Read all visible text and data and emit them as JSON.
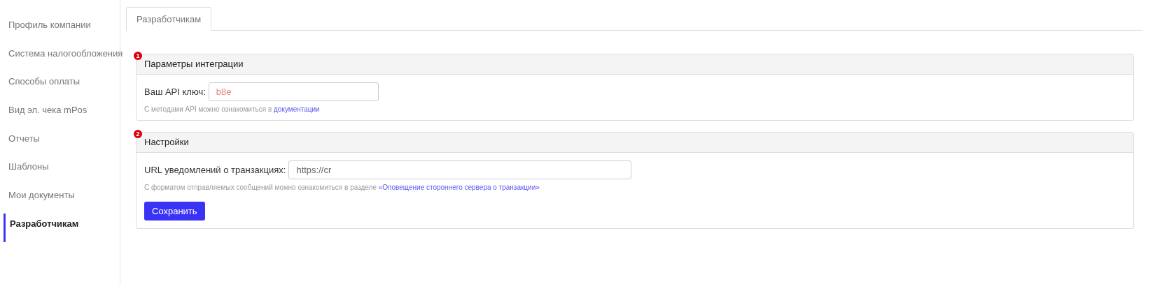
{
  "sidebar": {
    "items": [
      {
        "label": "Профиль компании",
        "selected": false
      },
      {
        "label": "Система налогообложения",
        "selected": false
      },
      {
        "label": "Способы оплаты",
        "selected": false
      },
      {
        "label": "Вид эл. чека mPos",
        "selected": false
      },
      {
        "label": "Отчеты",
        "selected": false
      },
      {
        "label": "Шаблоны",
        "selected": false
      },
      {
        "label": "Мои документы",
        "selected": false
      },
      {
        "label": "Разработчикам",
        "selected": true
      }
    ]
  },
  "tabs": [
    {
      "label": "Разработчикам",
      "selected": true
    }
  ],
  "panels": [
    {
      "badge": "1",
      "title": "Параметры интеграции",
      "field": {
        "label": "Ваш API ключ:",
        "value": "b8e",
        "kind": "key"
      },
      "hint": "С методами API можно ознакомиться в ",
      "link": "документации"
    },
    {
      "badge": "2",
      "title": "Настройки",
      "field": {
        "label": "URL уведомлений о транзакциях:",
        "value": "https://cr",
        "kind": "url"
      },
      "hint": "С форматом отправляемых сообщений можно ознакомиться в разделе ",
      "link": "«Оповещение стороннего сервера о транзакции»",
      "button": "Сохранить"
    }
  ]
}
